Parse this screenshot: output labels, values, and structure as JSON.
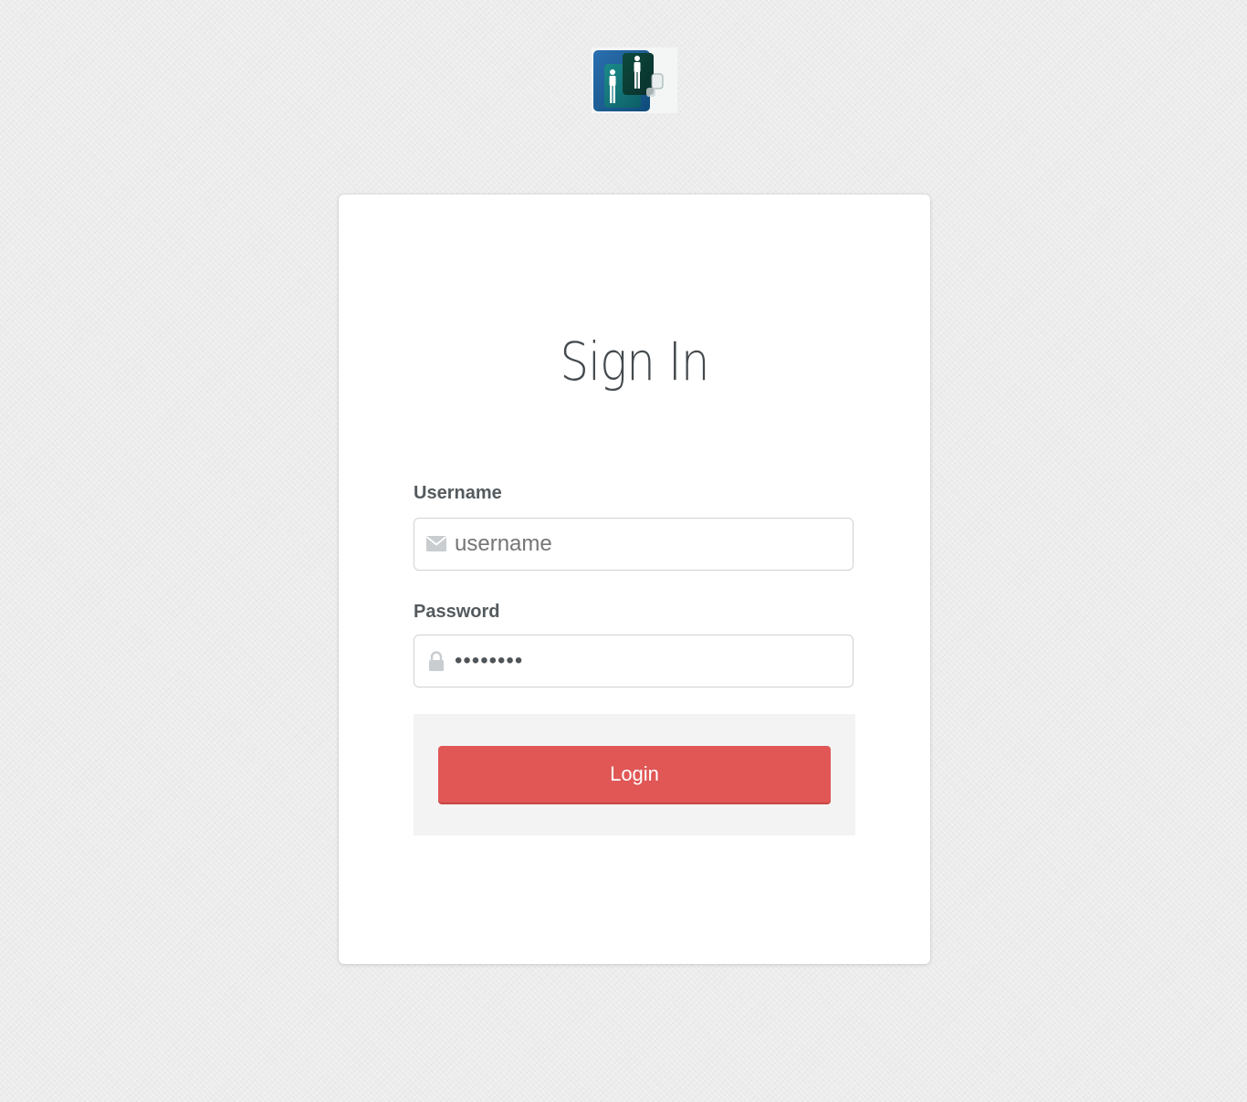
{
  "logo": {
    "icon": "people-logo-icon",
    "colors": [
      "#1c5a8f",
      "#0e6b74",
      "#0b3d33"
    ]
  },
  "form": {
    "title": "Sign In",
    "username": {
      "label": "Username",
      "placeholder": "username",
      "icon": "envelope-icon"
    },
    "password": {
      "label": "Password",
      "value": "••••••••",
      "icon": "lock-icon"
    },
    "submit_label": "Login"
  },
  "colors": {
    "accent": "#e05756",
    "background": "#ececec",
    "card": "#ffffff"
  }
}
